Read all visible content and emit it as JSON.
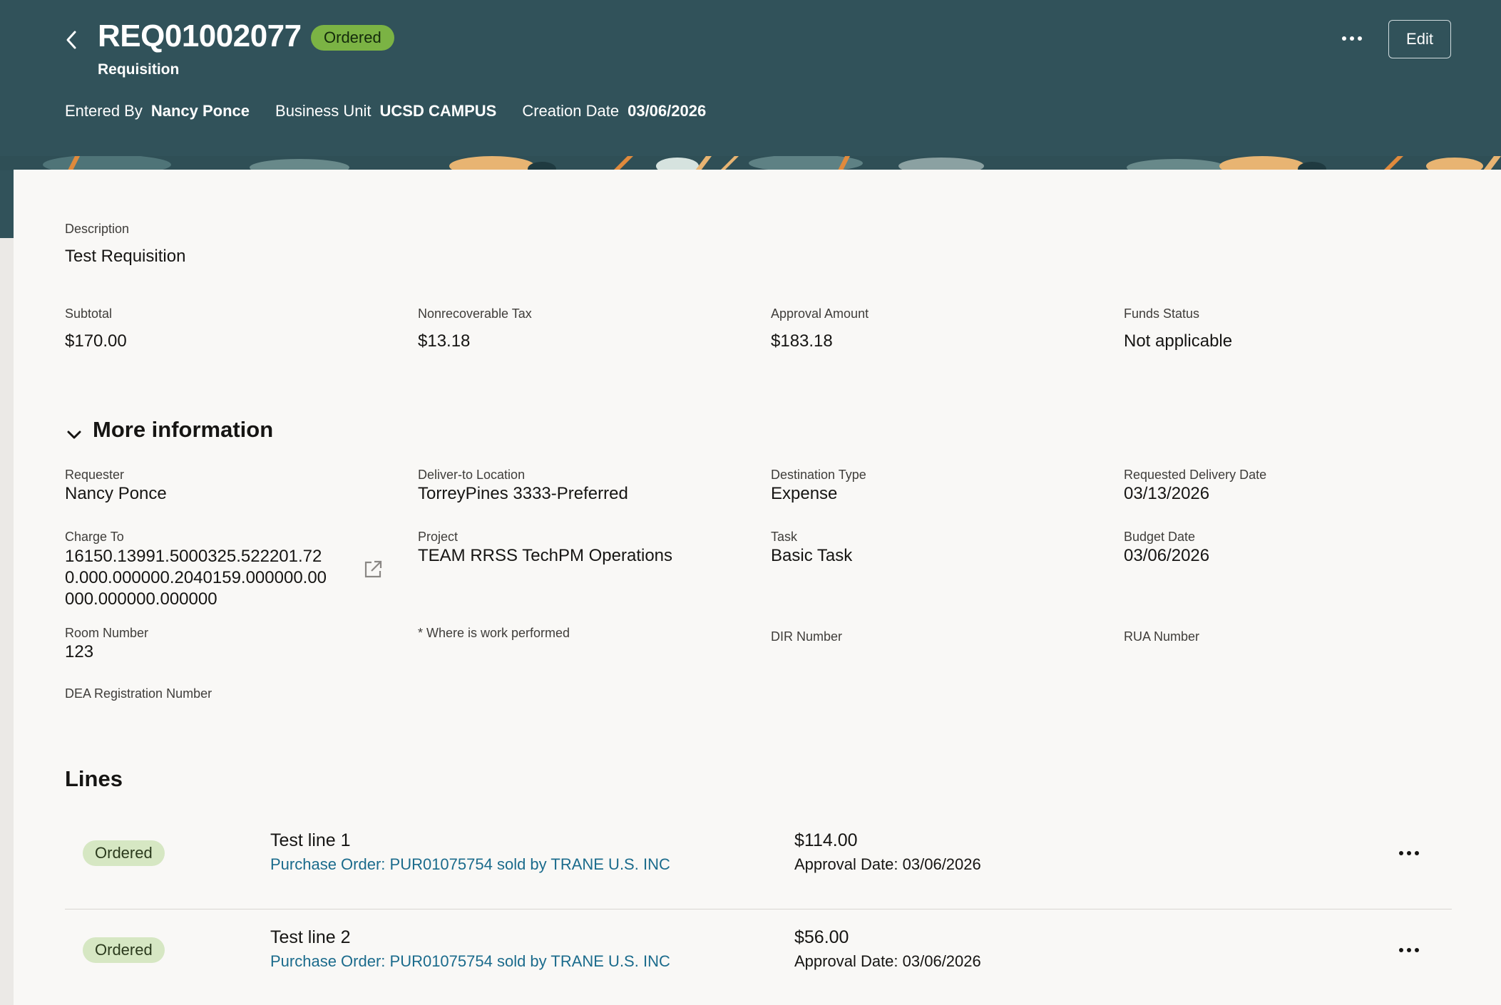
{
  "header": {
    "title": "REQ01002077",
    "status": "Ordered",
    "subtitle": "Requisition",
    "entered_by_label": "Entered By",
    "entered_by_value": "Nancy Ponce",
    "business_unit_label": "Business Unit",
    "business_unit_value": "UCSD CAMPUS",
    "creation_date_label": "Creation Date",
    "creation_date_value": "03/06/2026",
    "edit_label": "Edit",
    "icons": {
      "back": "chevron-left-icon",
      "more": "more-actions-icon"
    }
  },
  "summary": {
    "description_label": "Description",
    "description_value": "Test Requisition",
    "subtotal_label": "Subtotal",
    "subtotal_value": "$170.00",
    "tax_label": "Nonrecoverable Tax",
    "tax_value": "$13.18",
    "approval_label": "Approval Amount",
    "approval_value": "$183.18",
    "funds_label": "Funds Status",
    "funds_value": "Not applicable"
  },
  "more_info": {
    "title": "More information",
    "requester_label": "Requester",
    "requester_value": "Nancy Ponce",
    "deliver_label": "Deliver-to Location",
    "deliver_value": "TorreyPines 3333-Preferred",
    "dest_type_label": "Destination Type",
    "dest_type_value": "Expense",
    "req_delivery_label": "Requested Delivery Date",
    "req_delivery_value": "03/13/2026",
    "charge_to_label": "Charge To",
    "charge_to_lines": [
      "16150.13991.5000325.522201.72",
      "0.000.000000.2040159.000000.00",
      "000.000000.000000"
    ],
    "project_label": "Project",
    "project_value": "TEAM RRSS TechPM Operations",
    "task_label": "Task",
    "task_value": "Basic Task",
    "budget_date_label": "Budget Date",
    "budget_date_value": "03/06/2026",
    "room_label": "Room Number",
    "room_value": "123",
    "where_label": "* Where is work performed",
    "dir_label": "DIR Number",
    "rua_label": "RUA Number",
    "dea_label": "DEA Registration Number"
  },
  "lines": {
    "title": "Lines",
    "items": [
      {
        "status": "Ordered",
        "name": "Test line 1",
        "po_link": "Purchase Order: PUR01075754 sold by TRANE U.S. INC",
        "amount": "$114.00",
        "approval": "Approval Date: 03/06/2026"
      },
      {
        "status": "Ordered",
        "name": "Test line 2",
        "po_link": "Purchase Order: PUR01075754 sold by TRANE U.S. INC",
        "amount": "$56.00",
        "approval": "Approval Date: 03/06/2026"
      }
    ]
  },
  "colors": {
    "header_bg": "#31525a",
    "status_header": "#7bb344",
    "status_line": "#d6e7c3",
    "link": "#1b6b8c",
    "card_bg": "#f9f8f6"
  }
}
